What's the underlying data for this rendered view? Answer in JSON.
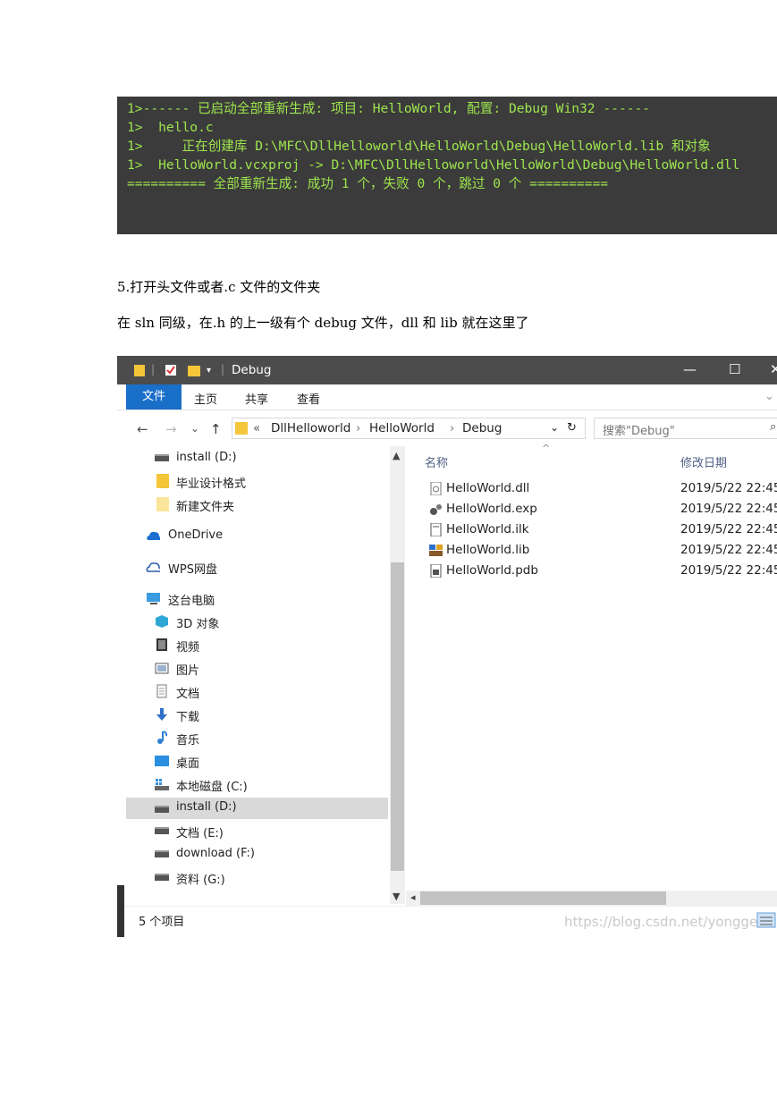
{
  "console": {
    "lines": [
      "1>------ 已启动全部重新生成: 项目: HelloWorld, 配置: Debug Win32 ------",
      "1>  hello.c",
      "1>     正在创建库 D:\\MFC\\DllHelloworld\\HelloWorld\\Debug\\HelloWorld.lib 和对象",
      "1>  HelloWorld.vcxproj -> D:\\MFC\\DllHelloworld\\HelloWorld\\Debug\\HelloWorld.dll",
      "========== 全部重新生成: 成功 1 个，失败 0 个，跳过 0 个 =========="
    ],
    "text_color": "#9ee64e",
    "background": "#3b3b3b"
  },
  "doc": {
    "step5": "5.打开头文件或者.c 文件的文件夹",
    "note": "在 sln 同级，在.h 的上一级有个 debug 文件，dll 和 lib 就在这里了"
  },
  "explorer": {
    "title": "Debug",
    "window_buttons": {
      "minimize": "—",
      "maximize": "☐",
      "close": "✕"
    },
    "ribbon_tabs": [
      "文件",
      "主页",
      "共享",
      "查看"
    ],
    "nav_arrows": {
      "back": "←",
      "forward": "→",
      "recent": "⌄",
      "up": "↑"
    },
    "breadcrumb": [
      "«",
      "DllHelloworld",
      "›",
      "HelloWorld",
      "›",
      "Debug"
    ],
    "refresh": "↻",
    "search_placeholder": "搜索\"Debug\"",
    "nav_items": [
      {
        "label": "install (D:)",
        "icon": "drive-icon"
      },
      {
        "label": "毕业设计格式",
        "icon": "folder-icon"
      },
      {
        "label": "新建文件夹",
        "icon": "folder-icon"
      },
      {
        "label": "OneDrive",
        "icon": "cloud-icon"
      },
      {
        "label": "WPS网盘",
        "icon": "wps-cloud-icon"
      },
      {
        "label": "这台电脑",
        "icon": "pc-icon"
      },
      {
        "label": "3D 对象",
        "icon": "cube-icon"
      },
      {
        "label": "视频",
        "icon": "video-icon"
      },
      {
        "label": "图片",
        "icon": "picture-icon"
      },
      {
        "label": "文档",
        "icon": "document-icon"
      },
      {
        "label": "下载",
        "icon": "download-icon"
      },
      {
        "label": "音乐",
        "icon": "music-icon"
      },
      {
        "label": "桌面",
        "icon": "desktop-icon"
      },
      {
        "label": "本地磁盘 (C:)",
        "icon": "windows-drive-icon"
      },
      {
        "label": "install (D:)",
        "icon": "drive-icon",
        "selected": true
      },
      {
        "label": "文档 (E:)",
        "icon": "drive-icon"
      },
      {
        "label": "download (F:)",
        "icon": "drive-icon"
      },
      {
        "label": "资料 (G:)",
        "icon": "drive-icon"
      }
    ],
    "columns": {
      "name": "名称",
      "date": "修改日期"
    },
    "files": [
      {
        "name": "HelloWorld.dll",
        "date": "2019/5/22 22:45",
        "icon": "dll-file-icon"
      },
      {
        "name": "HelloWorld.exp",
        "date": "2019/5/22 22:45",
        "icon": "exp-file-icon"
      },
      {
        "name": "HelloWorld.ilk",
        "date": "2019/5/22 22:45",
        "icon": "ilk-file-icon"
      },
      {
        "name": "HelloWorld.lib",
        "date": "2019/5/22 22:45",
        "icon": "lib-file-icon"
      },
      {
        "name": "HelloWorld.pdb",
        "date": "2019/5/22 22:45",
        "icon": "pdb-file-icon"
      }
    ],
    "status": "5 个项目",
    "watermark": "https://blog.csdn.net/yongge",
    "accent": "#1a6fc9"
  }
}
